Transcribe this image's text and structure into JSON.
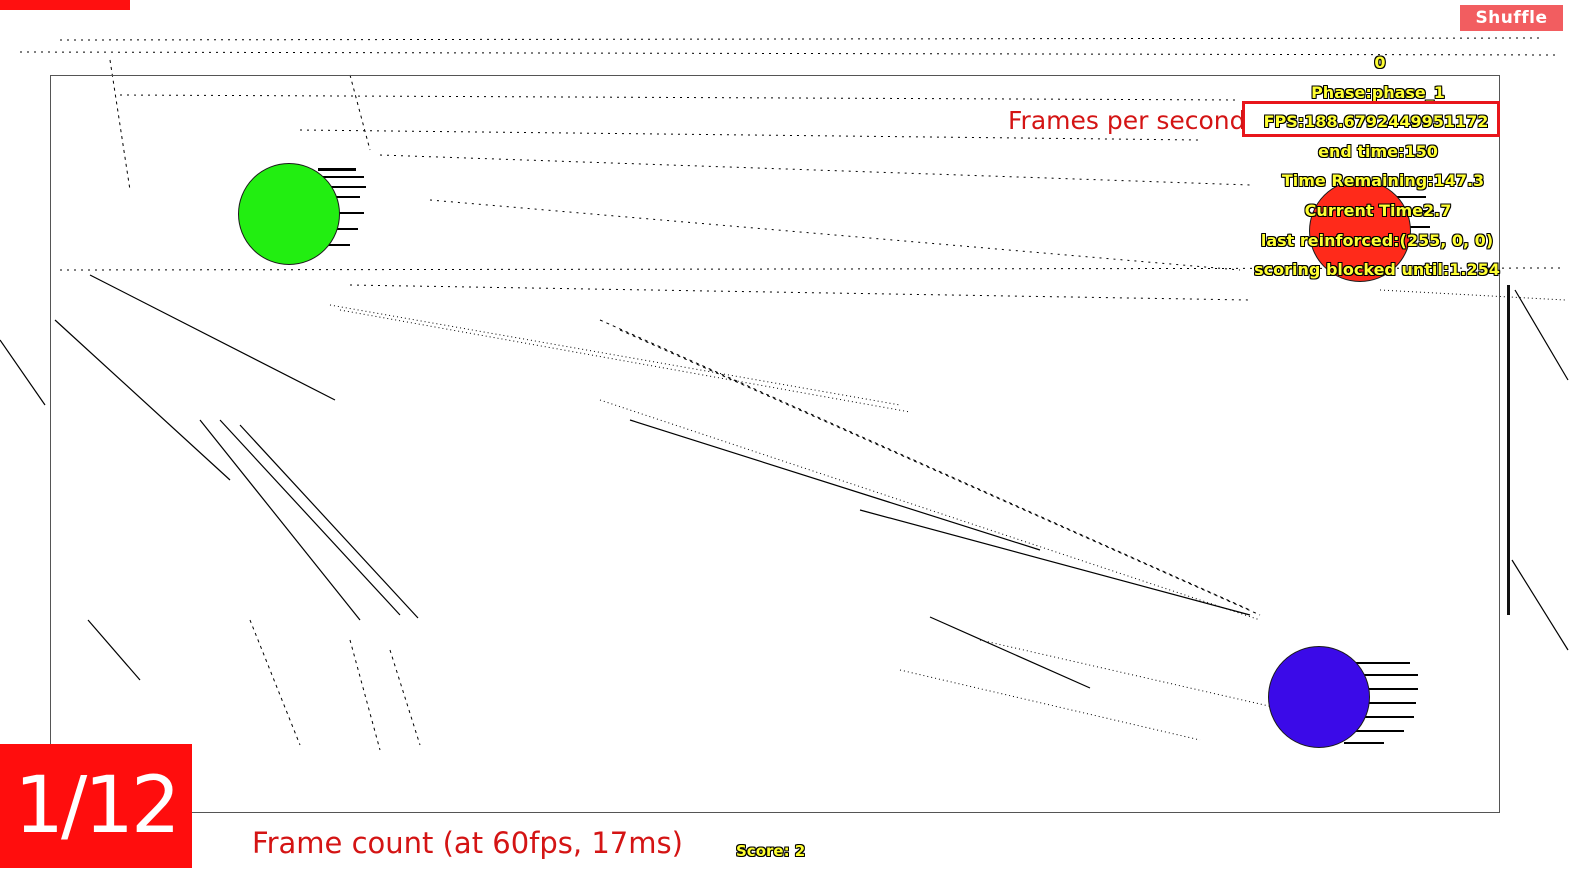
{
  "toolbar": {
    "shuffle_label": "Shuffle"
  },
  "hud": {
    "counter": "0",
    "phase": "Phase:phase_1",
    "fps": "FPS:188.6792449951172",
    "end_time": "end time:150",
    "time_remaining": "Time Remaining:147.3",
    "current_time": "Current Time2.7",
    "last_reinforced": "last reinforced:(255, 0, 0)",
    "scoring_blocked": "scoring blocked until:1.254",
    "score": "Score: 2"
  },
  "annotations": {
    "fps_label": "Frames per second",
    "frame_count_label": "Frame count (at 60fps, 17ms)",
    "slide_counter": "1/12"
  },
  "colors": {
    "hud_text": "#ffff33",
    "annotation": "#d41414",
    "ball_green": "#22ee11",
    "ball_red": "#ff2a1a",
    "ball_blue": "#3b0ae8",
    "shuffle_bg": "#f25d60",
    "counter_bg": "#ff0d0d"
  },
  "targets": [
    {
      "name": "target-green",
      "color": "#22ee11"
    },
    {
      "name": "target-red",
      "color": "#ff2a1a"
    },
    {
      "name": "target-blue",
      "color": "#3b0ae8"
    }
  ]
}
